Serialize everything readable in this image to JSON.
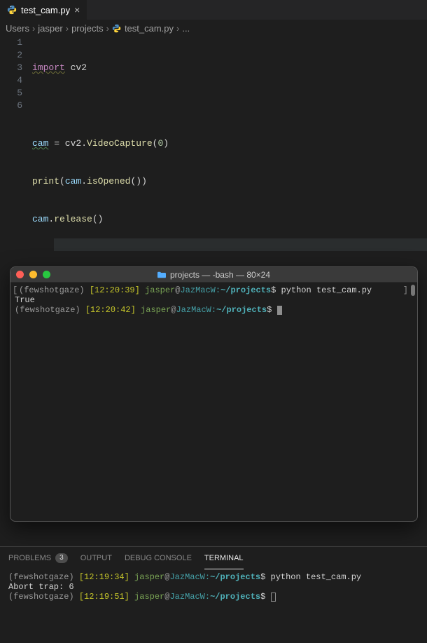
{
  "tab": {
    "filename": "test_cam.py"
  },
  "breadcrumbs": {
    "seg1": "Users",
    "seg2": "jasper",
    "seg3": "projects",
    "seg4": "test_cam.py",
    "seg5": "..."
  },
  "editor": {
    "lines": {
      "n1": "1",
      "n2": "2",
      "n3": "3",
      "n4": "4",
      "n5": "5",
      "n6": "6"
    },
    "code": {
      "l1_import": "import",
      "l1_mod": " cv2",
      "l3_var": "cam",
      "l3_rest_a": " = cv2.",
      "l3_func": "VideoCapture",
      "l3_open": "(",
      "l3_num": "0",
      "l3_close": ")",
      "l4_print": "print",
      "l4_open": "(",
      "l4_var": "cam",
      "l4_dot": ".",
      "l4_func": "isOpened",
      "l4_paren": "()",
      "l4_close": ")",
      "l5_var": "cam",
      "l5_dot": ".",
      "l5_func": "release",
      "l5_paren": "()"
    }
  },
  "macterm": {
    "title": "projects — -bash — 80×24",
    "line1": {
      "env": "(fewshotgaze)",
      "time": " [12:20:39] ",
      "user": "jasper",
      "at": "@",
      "host": "JazMacW:",
      "path": "~/projects",
      "dollar": "$ ",
      "cmd": "python test_cam.py"
    },
    "out1": "True",
    "line2": {
      "env": "(fewshotgaze)",
      "time": " [12:20:42] ",
      "user": "jasper",
      "at": "@",
      "host": "JazMacW:",
      "path": "~/projects",
      "dollar": "$ "
    }
  },
  "panel": {
    "problems": "PROBLEMS",
    "problems_badge": "3",
    "output": "OUTPUT",
    "debug": "DEBUG CONSOLE",
    "terminal": "TERMINAL"
  },
  "bottomterm": {
    "line1": {
      "env": "(fewshotgaze)",
      "time": " [12:19:34] ",
      "user": "jasper",
      "at": "@",
      "host": "JazMacW:",
      "path": "~/projects",
      "dollar": "$ ",
      "cmd": "python test_cam.py"
    },
    "out1": "Abort trap: 6",
    "line2": {
      "env": "(fewshotgaze)",
      "time": " [12:19:51] ",
      "user": "jasper",
      "at": "@",
      "host": "JazMacW:",
      "path": "~/projects",
      "dollar": "$ "
    }
  }
}
